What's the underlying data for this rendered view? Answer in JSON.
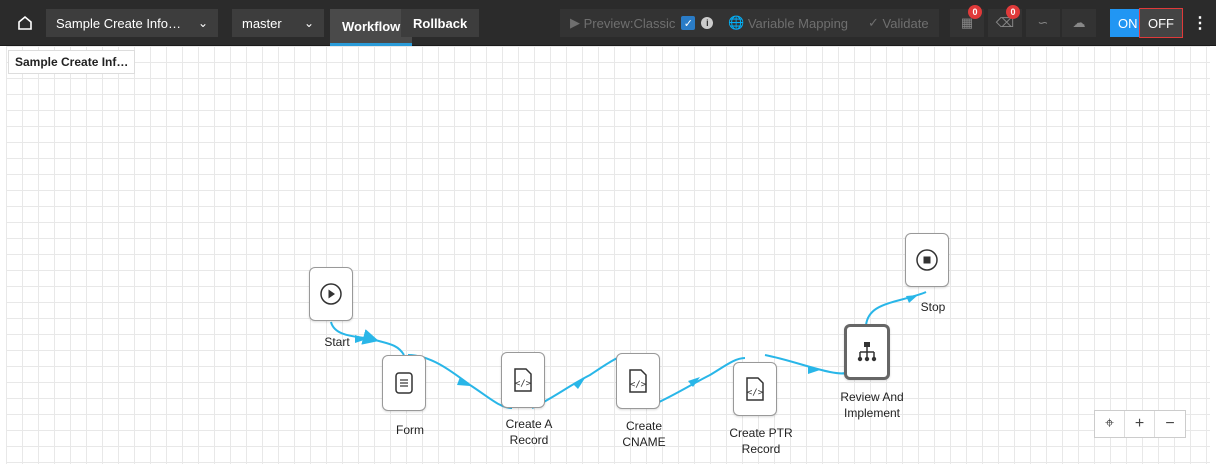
{
  "toolbar": {
    "workflow_select": "Sample Create Info…",
    "branch_select": "master",
    "tab_workflow": "Workflow",
    "tab_rollback": "Rollback",
    "preview_label": "Preview:Classic",
    "variable_mapping": "Variable Mapping",
    "validate": "Validate",
    "badge_1": "0",
    "badge_2": "0",
    "toggle_on": "ON",
    "toggle_off": "OFF"
  },
  "canvas": {
    "workflow_title": "Sample Create Inf…",
    "nodes": [
      {
        "label": "Start",
        "icon": "play-icon"
      },
      {
        "label": "Form",
        "icon": "form-icon"
      },
      {
        "label": "Create A Record",
        "icon": "code-file-icon"
      },
      {
        "label": "Create CNAME",
        "icon": "code-file-icon"
      },
      {
        "label": "Create PTR Record",
        "icon": "code-file-icon"
      },
      {
        "label": "Review And Implement",
        "icon": "hierarchy-icon"
      },
      {
        "label": "Stop",
        "icon": "stop-icon"
      }
    ]
  },
  "zoom": {
    "plus": "+",
    "minus": "−"
  },
  "colors": {
    "accent": "#2a9bd8",
    "connector": "#29b6e8",
    "on": "#2196f3",
    "badge": "#e03a3a"
  }
}
